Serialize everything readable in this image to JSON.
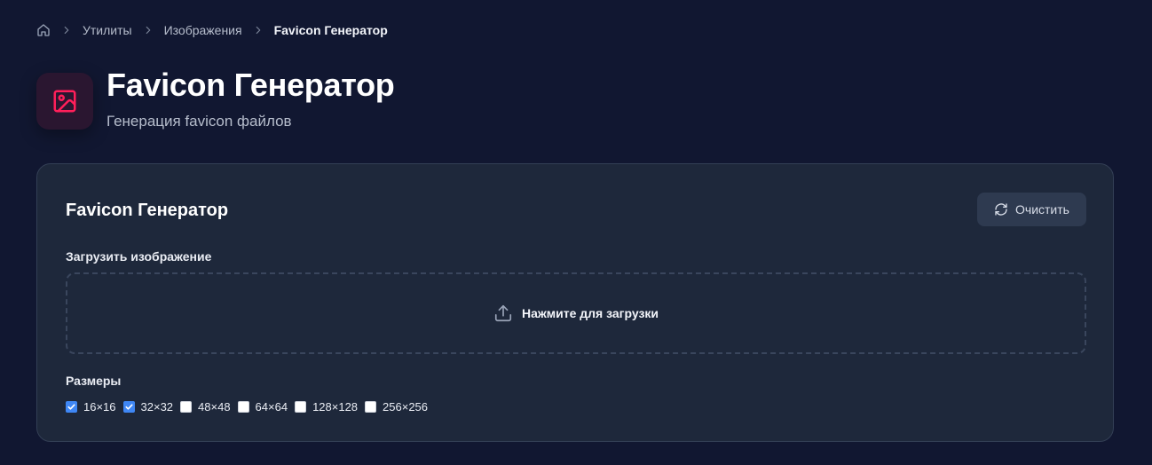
{
  "breadcrumb": {
    "items": [
      "Утилиты",
      "Изображения"
    ],
    "current": "Favicon Генератор"
  },
  "header": {
    "title": "Favicon Генератор",
    "subtitle": "Генерация favicon файлов",
    "icon": "image-icon",
    "icon_color": "#ff1f5a"
  },
  "card": {
    "title": "Favicon Генератор",
    "clear_label": "Очистить",
    "upload_label": "Загрузить изображение",
    "dropzone_text": "Нажмите для загрузки",
    "sizes_label": "Размеры",
    "sizes": [
      {
        "label": "16×16",
        "checked": true
      },
      {
        "label": "32×32",
        "checked": true
      },
      {
        "label": "48×48",
        "checked": false
      },
      {
        "label": "64×64",
        "checked": false
      },
      {
        "label": "128×128",
        "checked": false
      },
      {
        "label": "256×256",
        "checked": false
      }
    ]
  },
  "colors": {
    "background": "#111731",
    "card": "#1e283b",
    "accent": "#3f87f5"
  }
}
